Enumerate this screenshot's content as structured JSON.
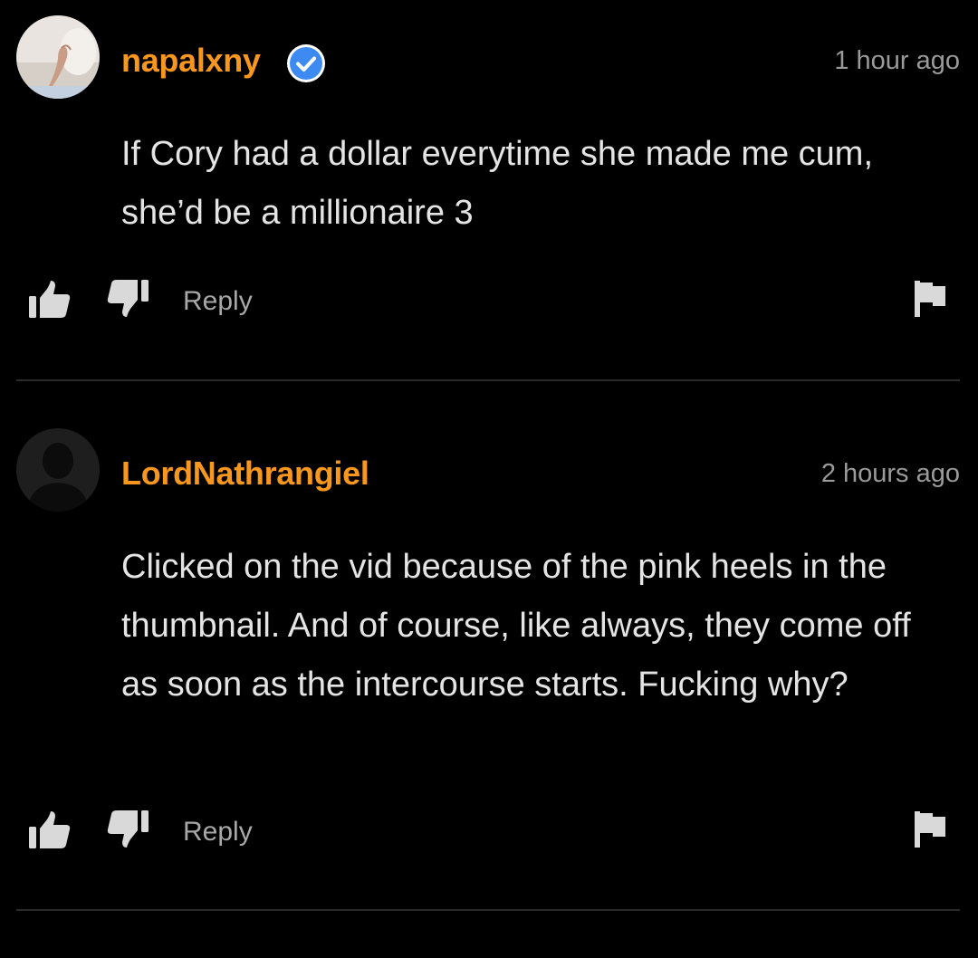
{
  "comments": [
    {
      "username": "napalxny",
      "verified": true,
      "timestamp": "1 hour ago",
      "text": "If Cory had a dollar everytime she made me cum, she’d be a millionaire 3",
      "reply_label": "Reply",
      "avatar": "photo-avatar"
    },
    {
      "username": "LordNathrangiel",
      "verified": false,
      "timestamp": "2 hours ago",
      "text": "Clicked on the vid because of the pink heels in the thumbnail. And of course, like always, they come off as soon as the intercourse starts. Fucking why?",
      "reply_label": "Reply",
      "avatar": "default-silhouette-avatar"
    }
  ],
  "colors": {
    "background": "#000000",
    "username": "#f7971e",
    "verified_badge": "#3d8bf2",
    "timestamp": "#9a9a9a",
    "body_text": "#e4e4e4",
    "icons": "#d9d9d9",
    "divider": "#2a2a2a"
  },
  "icons": [
    "thumbs-up-icon",
    "thumbs-down-icon",
    "flag-icon",
    "verified-icon"
  ]
}
